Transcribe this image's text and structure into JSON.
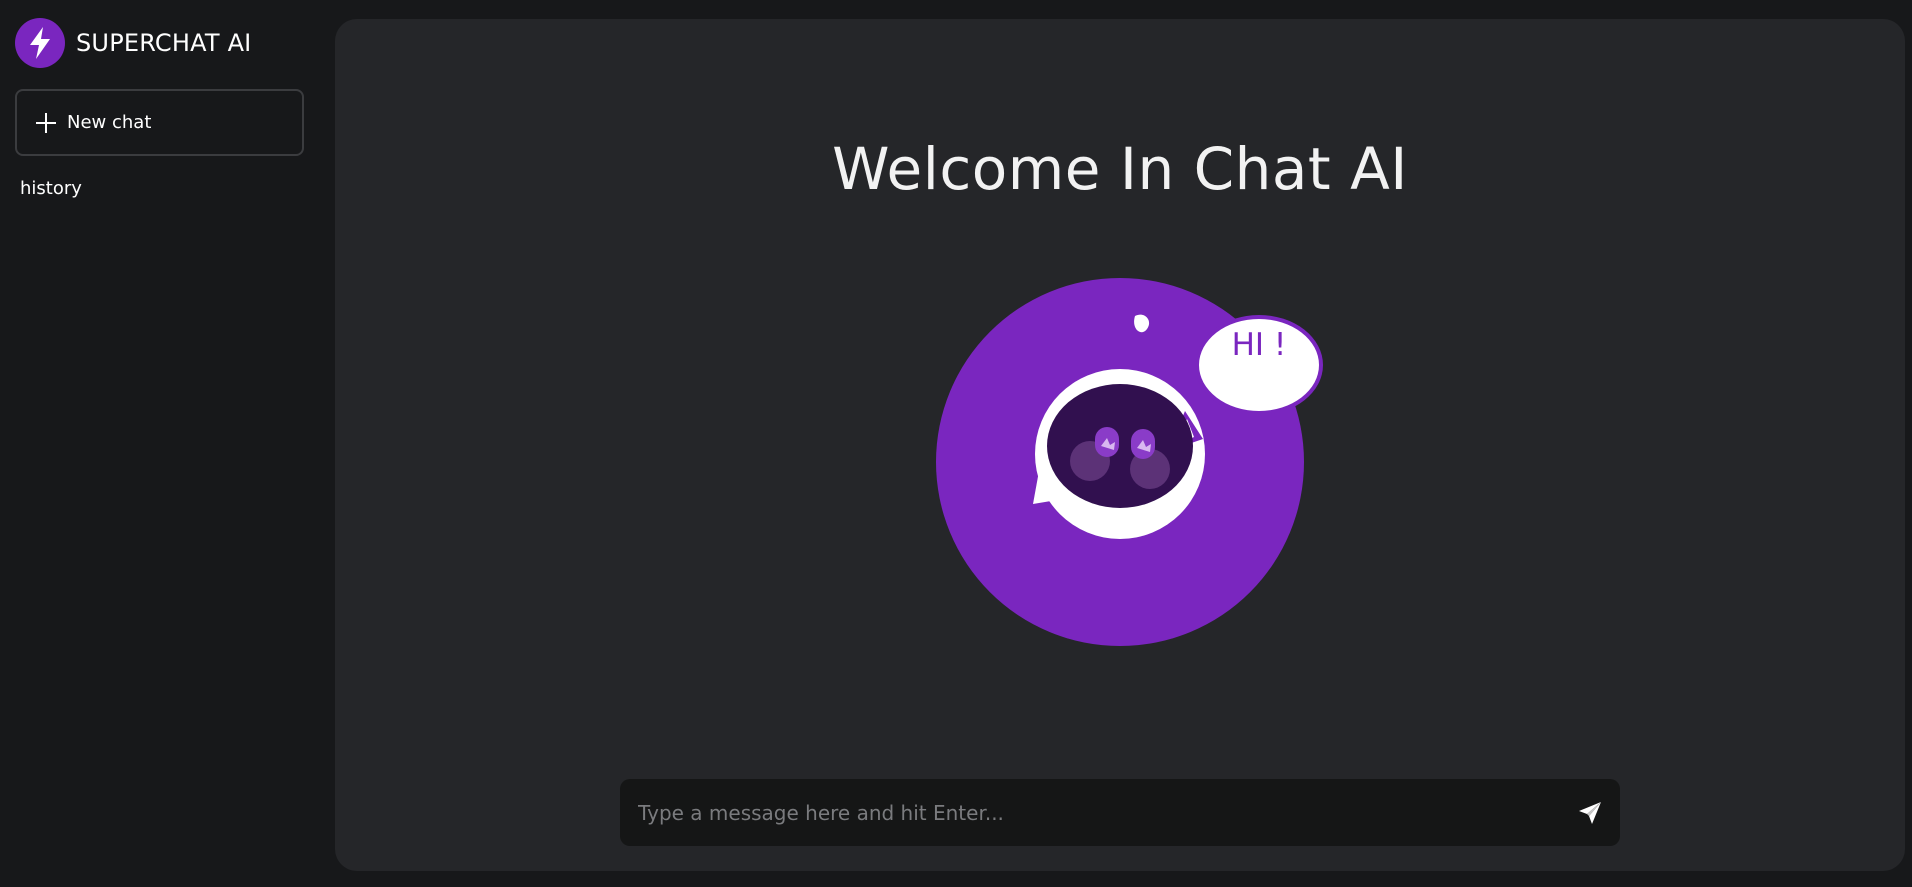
{
  "sidebar": {
    "brand_name": "SUPERCHAT AI",
    "new_chat_label": "New chat",
    "history_label": "history"
  },
  "main": {
    "welcome_title": "Welcome In Chat AI",
    "bubble_text": "HI !",
    "composer": {
      "placeholder": "Type a message here and hit Enter...",
      "value": ""
    }
  },
  "icons": {
    "brand": "lightning-icon",
    "new_chat": "plus-icon",
    "send": "paper-plane-icon"
  },
  "colors": {
    "accent": "#7a26bf",
    "background": "#17181a",
    "panel": "#252629",
    "input_bg": "#151616"
  }
}
